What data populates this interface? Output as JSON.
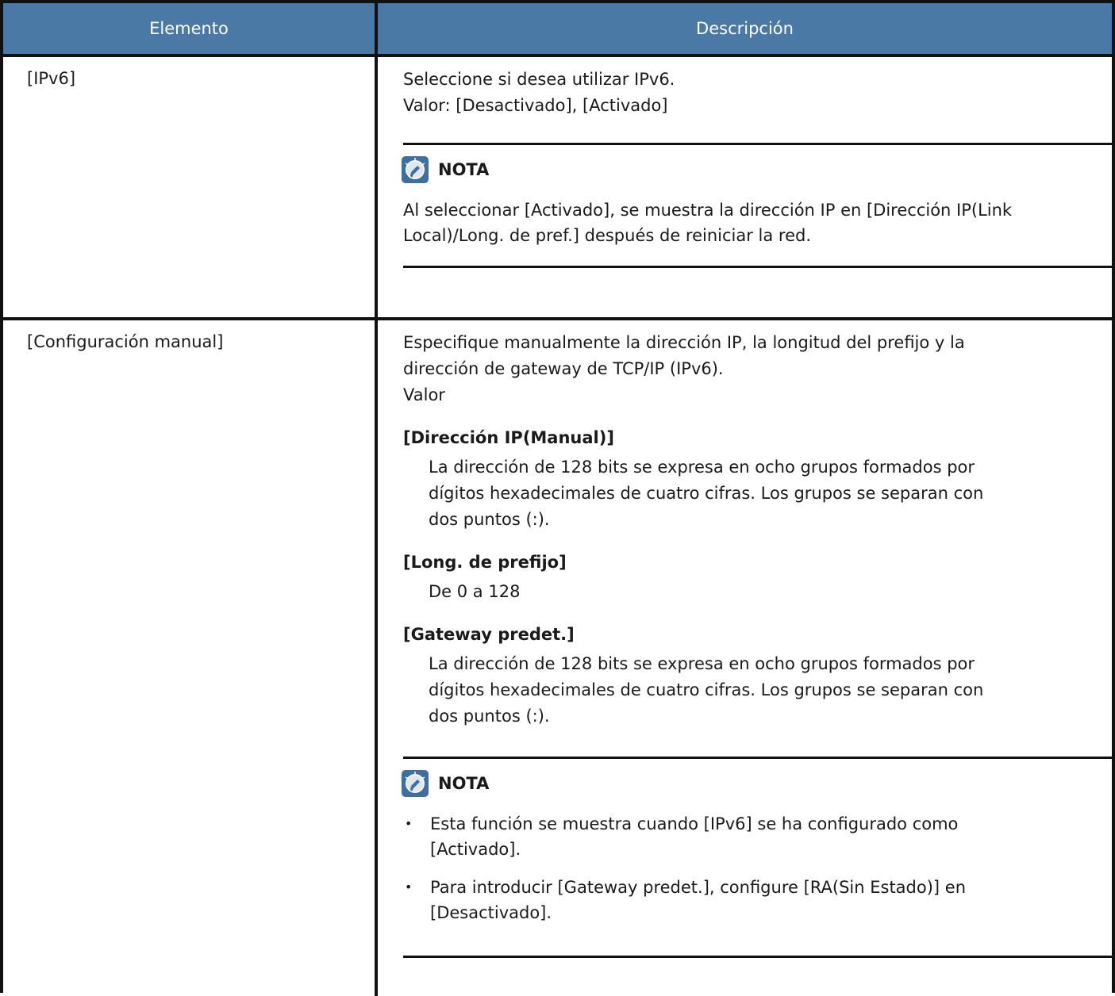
{
  "table": {
    "header": {
      "col1": "Elemento",
      "col2": "Descripción"
    },
    "rows": [
      {
        "item": "[IPv6]",
        "desc_lines": [
          "Seleccione si desea utilizar IPv6.",
          "Valor: [Desactivado], [Activado]"
        ],
        "note": {
          "title": "NOTA",
          "icon": "lightbulb-note-icon",
          "text_line1": "Al seleccionar [Activado], se muestra la dirección IP en [Dirección IP(Link",
          "text_line2": "Local)/Long. de pref.] después de reiniciar la red."
        }
      },
      {
        "item": "[Configuración manual]",
        "desc_line1": "Especifique manualmente la dirección IP, la longitud del prefijo y la",
        "desc_line2": "dirección de gateway de TCP/IP (IPv6).",
        "value_label": "Valor",
        "subsections": [
          {
            "title": "[Dirección IP(Manual)]",
            "lines": [
              "La dirección de 128 bits se expresa en ocho grupos formados por",
              "dígitos hexadecimales de cuatro cifras. Los grupos se separan con",
              "dos puntos (:)."
            ]
          },
          {
            "title": "[Long. de prefijo]",
            "lines": [
              "De 0 a 128"
            ]
          },
          {
            "title": "[Gateway predet.]",
            "lines": [
              "La dirección de 128 bits se expresa en ocho grupos formados por",
              "dígitos hexadecimales de cuatro cifras. Los grupos se separan con",
              "dos puntos (:)."
            ]
          }
        ],
        "note": {
          "title": "NOTA",
          "icon": "lightbulb-note-icon",
          "bullets": [
            {
              "line1": "Esta función se muestra cuando [IPv6] se ha configurado como",
              "line2": "[Activado]."
            },
            {
              "line1": "Para introducir [Gateway predet.], configure [RA(Sin Estado)] en",
              "line2": "[Desactivado]."
            }
          ],
          "bullet_char": "•"
        }
      }
    ]
  },
  "colors": {
    "header_bg": "#4a79a5",
    "header_text": "#ffffff",
    "border": "#111111"
  }
}
